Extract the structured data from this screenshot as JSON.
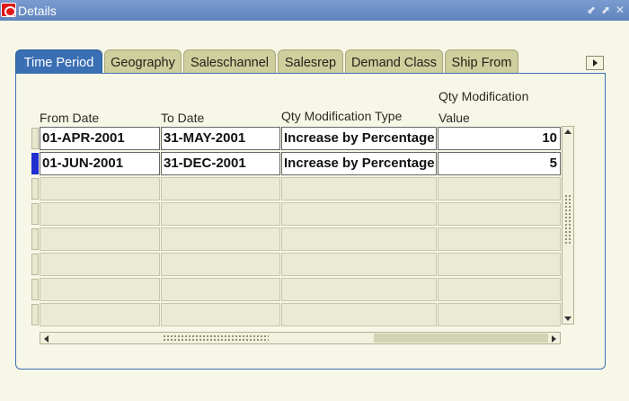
{
  "window": {
    "title": "Details",
    "controls": [
      "minimize-icon",
      "restore-icon",
      "close-icon"
    ]
  },
  "tabs": [
    {
      "label": "Time Period",
      "active": true
    },
    {
      "label": "Geography",
      "active": false
    },
    {
      "label": "Saleschannel",
      "active": false
    },
    {
      "label": "Salesrep",
      "active": false
    },
    {
      "label": "Demand Class",
      "active": false
    },
    {
      "label": "Ship From",
      "active": false
    }
  ],
  "table": {
    "columns": {
      "from_date": "From Date",
      "to_date": "To Date",
      "qty_mod_type": "Qty Modification Type",
      "qty_mod_value_line1": "Qty Modification",
      "qty_mod_value_line2": "Value"
    },
    "rows": [
      {
        "from_date": "01-APR-2001",
        "to_date": "31-MAY-2001",
        "type": "Increase by Percentage",
        "value": "10"
      },
      {
        "from_date": "01-JUN-2001",
        "to_date": "31-DEC-2001",
        "type": "Increase by Percentage",
        "value": "5"
      }
    ],
    "current_row": 1,
    "empty_rows": 6
  },
  "colors": {
    "title_bar": "#6a8fc6",
    "active_tab": "#3a6fb4",
    "inactive_tab": "#cfcf9e",
    "background": "#f7f7e7",
    "current_row_indicator": "#1f2fd0"
  }
}
